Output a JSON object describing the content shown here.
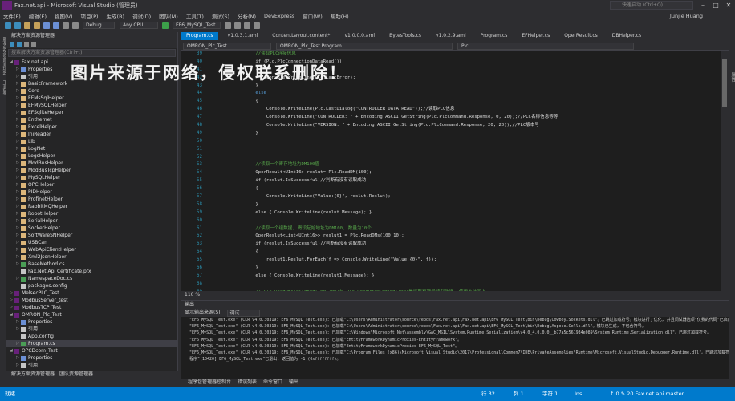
{
  "window": {
    "title": "Fax.net.api - Microsoft Visual Studio (管理员)",
    "quick_launch": "快速启动 (Ctrl+Q)",
    "user": "Junjie Huang"
  },
  "menu": [
    "文件(F)",
    "编辑(E)",
    "视图(V)",
    "项目(P)",
    "生成(B)",
    "调试(D)",
    "团队(M)",
    "工具(T)",
    "测试(S)",
    "分析(N)",
    "DevExpress",
    "窗口(W)",
    "帮助(H)"
  ],
  "toolbar": {
    "config": "Debug",
    "platform": "Any CPU",
    "startup": "EF6_MySQL_Test"
  },
  "left_strip": [
    "服务器资源管理器",
    "工具箱"
  ],
  "right_strip": [
    "属性"
  ],
  "solution_explorer": {
    "title": "解决方案资源管理器",
    "search_placeholder": "搜索解决方案资源管理器(Ctrl+;)",
    "items": [
      {
        "label": "Fax.net.api",
        "type": "proj",
        "indent": 0,
        "arrow": "◢"
      },
      {
        "label": "Properties",
        "type": "prop",
        "indent": 1,
        "arrow": "▷"
      },
      {
        "label": "引用",
        "type": "file",
        "indent": 1,
        "arrow": "▷"
      },
      {
        "label": "BasicFramework",
        "type": "folder",
        "indent": 1,
        "arrow": "▷"
      },
      {
        "label": "Core",
        "type": "folder",
        "indent": 1,
        "arrow": "▷"
      },
      {
        "label": "EFMsSqlHelper",
        "type": "folder",
        "indent": 1,
        "arrow": "▷"
      },
      {
        "label": "EFMySQLHelper",
        "type": "folder",
        "indent": 1,
        "arrow": "▷"
      },
      {
        "label": "EFSqliteHelper",
        "type": "folder",
        "indent": 1,
        "arrow": "▷"
      },
      {
        "label": "Enthernet",
        "type": "folder",
        "indent": 1,
        "arrow": "▷"
      },
      {
        "label": "ExcelHelper",
        "type": "folder",
        "indent": 1,
        "arrow": "▷"
      },
      {
        "label": "IniReader",
        "type": "folder",
        "indent": 1,
        "arrow": "▷"
      },
      {
        "label": "Lib",
        "type": "folder",
        "indent": 1,
        "arrow": "▷"
      },
      {
        "label": "LogNet",
        "type": "folder",
        "indent": 1,
        "arrow": "▷"
      },
      {
        "label": "LogsHelper",
        "type": "folder",
        "indent": 1,
        "arrow": "▷"
      },
      {
        "label": "ModBusHelper",
        "type": "folder",
        "indent": 1,
        "arrow": "▷"
      },
      {
        "label": "ModBusTcpHelper",
        "type": "folder",
        "indent": 1,
        "arrow": "▷"
      },
      {
        "label": "MySQLHelper",
        "type": "folder",
        "indent": 1,
        "arrow": "▷"
      },
      {
        "label": "OPCHelper",
        "type": "folder",
        "indent": 1,
        "arrow": "▷"
      },
      {
        "label": "PIDHelper",
        "type": "folder",
        "indent": 1,
        "arrow": "▷"
      },
      {
        "label": "ProfinetHelper",
        "type": "folder",
        "indent": 1,
        "arrow": "▷"
      },
      {
        "label": "RabbitMQHelper",
        "type": "folder",
        "indent": 1,
        "arrow": "▷"
      },
      {
        "label": "RobotHelper",
        "type": "folder",
        "indent": 1,
        "arrow": "▷"
      },
      {
        "label": "SerialHelper",
        "type": "folder",
        "indent": 1,
        "arrow": "▷"
      },
      {
        "label": "SocketHelper",
        "type": "folder",
        "indent": 1,
        "arrow": "▷"
      },
      {
        "label": "SoftWareSNHelper",
        "type": "folder",
        "indent": 1,
        "arrow": "▷"
      },
      {
        "label": "USBCan",
        "type": "folder",
        "indent": 1,
        "arrow": "▷"
      },
      {
        "label": "WebApiClientHelper",
        "type": "folder",
        "indent": 1,
        "arrow": "▷"
      },
      {
        "label": "Xml2JsonHelper",
        "type": "folder",
        "indent": 1,
        "arrow": "▷"
      },
      {
        "label": "BaseMethod.cs",
        "type": "cs",
        "indent": 1,
        "arrow": "▷"
      },
      {
        "label": "Fax.Net.Api Certificate.pfx",
        "type": "file",
        "indent": 1,
        "arrow": ""
      },
      {
        "label": "NamespaceDoc.cs",
        "type": "cs",
        "indent": 1,
        "arrow": "▷"
      },
      {
        "label": "packages.config",
        "type": "file",
        "indent": 1,
        "arrow": ""
      },
      {
        "label": "MelsecPLC_Test",
        "type": "proj",
        "indent": 0,
        "arrow": "▷"
      },
      {
        "label": "ModbusServer_test",
        "type": "proj",
        "indent": 0,
        "arrow": "▷"
      },
      {
        "label": "ModbusTCP_Test",
        "type": "proj",
        "indent": 0,
        "arrow": "▷"
      },
      {
        "label": "OMRON_Plc_Test",
        "type": "proj",
        "indent": 0,
        "arrow": "◢"
      },
      {
        "label": "Properties",
        "type": "prop",
        "indent": 1,
        "arrow": "▷"
      },
      {
        "label": "引用",
        "type": "file",
        "indent": 1,
        "arrow": "▷"
      },
      {
        "label": "App.config",
        "type": "file",
        "indent": 1,
        "arrow": ""
      },
      {
        "label": "Program.cs",
        "type": "cs",
        "indent": 1,
        "arrow": "▷",
        "selected": true
      },
      {
        "label": "OPCDcom_Test",
        "type": "proj",
        "indent": 0,
        "arrow": "◢"
      },
      {
        "label": "Properties",
        "type": "prop",
        "indent": 1,
        "arrow": "▷"
      },
      {
        "label": "引用",
        "type": "file",
        "indent": 1,
        "arrow": "▷"
      }
    ],
    "bottom_tabs": [
      "解决方案资源管理器",
      "团队资源管理器"
    ]
  },
  "editor": {
    "tabs": [
      "Program.cs",
      "v1.0.3.1.aml",
      "ContentLayout.content*",
      "v1.0.0.0.aml",
      "BytesTools.cs",
      "v1.0.2.9.aml",
      "Program.cs",
      "EFHelper.cs",
      "OperResult.cs",
      "DBHelper.cs"
    ],
    "nav_left": "OMRON_Plc_Test",
    "nav_mid": "OMRON_Plc_Test.Program",
    "nav_right": "Plc",
    "zoom": "110 %",
    "line_numbers": [
      "39",
      "40",
      "41",
      "42",
      "43",
      "44",
      "45",
      "46",
      "47",
      "48",
      "49",
      "50",
      "51",
      "52",
      "53",
      "54",
      "55",
      "56",
      "57",
      "58",
      "59",
      "60",
      "61",
      "62",
      "63",
      "64",
      "65",
      "66",
      "67",
      "68",
      "69",
      "70",
      "71",
      "72",
      "73",
      "74"
    ],
    "lines": [
      {
        "t": "            //读取PLC连接信息",
        "c": "cm"
      },
      {
        "t": "            if (Plc.PlcConnectionDataRead())",
        "c": ""
      },
      {
        "t": "            {",
        "c": ""
      },
      {
        "t": "                Console.WriteLine(Plc.LastError);",
        "c": ""
      },
      {
        "t": "            }",
        "c": ""
      },
      {
        "t": "            else",
        "c": "kw"
      },
      {
        "t": "            {",
        "c": ""
      },
      {
        "t": "                Console.WriteLine(Plc.LastDialog(\"CONTROLLER DATA READ\"));//读取PLC信息",
        "c": ""
      },
      {
        "t": "                Console.WriteLine(\"CONTROLLER: \" + Encoding.ASCII.GetString(Plc.PlcCommand.Response, 0, 20));//PLC名称信息等等",
        "c": ""
      },
      {
        "t": "                Console.WriteLine(\"VERSION: \" + Encoding.ASCII.GetString(Plc.PlcCommand.Response, 20, 20));//PLC版本号",
        "c": ""
      },
      {
        "t": "            }",
        "c": ""
      },
      {
        "t": "",
        "c": ""
      },
      {
        "t": "",
        "c": ""
      },
      {
        "t": "",
        "c": ""
      },
      {
        "t": "            //读取一个寄存地址为DM100值",
        "c": "cm"
      },
      {
        "t": "            OperResult<UInt16> reslut= Plc.ReadDM(100);",
        "c": ""
      },
      {
        "t": "            if (reslut.IsSuccessful)//判断有没有读取成功",
        "c": ""
      },
      {
        "t": "            {",
        "c": ""
      },
      {
        "t": "                Console.WriteLine(\"Value:{0}\", reslut.Reslut);",
        "c": ""
      },
      {
        "t": "            }",
        "c": ""
      },
      {
        "t": "            else { Console.WriteLine(reslut.Message); }",
        "c": ""
      },
      {
        "t": "",
        "c": ""
      },
      {
        "t": "            //读取一个组数据, 寄设起始地址为DM100, 数量为10个",
        "c": "cm"
      },
      {
        "t": "            OperReslut<List<UInt16>> reslut1 = Plc.ReadDMs(100,10);",
        "c": ""
      },
      {
        "t": "            if (reslut.IsSuccessful)//判断有没有读取成功",
        "c": ""
      },
      {
        "t": "            {",
        "c": ""
      },
      {
        "t": "                reslut1.Reslut.ForEach(f => Console.WriteLine(\"Value:{0}\", f));",
        "c": ""
      },
      {
        "t": "            }",
        "c": ""
      },
      {
        "t": "            else { Console.WriteLine(reslut1.Message); }",
        "c": ""
      },
      {
        "t": "",
        "c": ""
      },
      {
        "t": "            // Plc.ReadDMsToSigned(100,100)与 Plc.ReadDMToSigned(100)是读取有符号整型数据, 使用方法同上,",
        "c": "cm"
      },
      {
        "t": "            //下面是写入数据的示例",
        "c": "cm"
      }
    ]
  },
  "watermark": "图片来源于网络，侵权联系删除！",
  "output": {
    "title": "输出",
    "source_label": "显示输出来源(S):",
    "source_value": "调试",
    "lines": [
      "\"EF6_MySQL_Test.exe\" (CLR v4.0.30319: EF6_MySQL_Test.exe): 已加载\"C:\\Users\\Administrator\\source\\repos\\Fax.net.api\\Fax.net.api\\EF6_MySQL_Test\\bin\\Debug\\Cowboy.Sockets.dll\"。已跳过加载符号。模块进行了优化, 并且调试器选项\"仅我的代码\"已启用。",
      "\"EF6_MySQL_Test.exe\" (CLR v4.0.30319: EF6_MySQL_Test.exe): 已加载\"C:\\Users\\Administrator\\source\\repos\\Fax.net.api\\Fax.net.api\\EF6_MySQL_Test\\bin\\Debug\\Aspose.Cells.dll\"。模块已生成, 不包含符号。",
      "\"EF6_MySQL_Test.exe\" (CLR v4.0.30319: EF6_MySQL_Test.exe): 已加载\"C:\\Windows\\Microsoft.Net\\assembly\\GAC_MSIL\\System.Runtime.Serialization\\v4.0_4.0.0.0__b77a5c561934e089\\System.Runtime.Serialization.dll\"。已跳过加载符号。",
      "\"EF6_MySQL_Test.exe\" (CLR v4.0.30319: EF6_MySQL_Test.exe): 已加载\"EntityFrameworkDynamicProxies-EntityFramework\"。",
      "\"EF6_MySQL_Test.exe\" (CLR v4.0.30319: EF6_MySQL_Test.exe): 已加载\"EntityFrameworkDynamicProxies-EF6_MySQL_Test\"。",
      "\"EF6_MySQL_Test.exe\" (CLR v4.0.30319: EF6_MySQL_Test.exe): 已加载\"C:\\Program Files (x86)\\Microsoft Visual Studio\\2017\\Professional\\Common7\\IDE\\PrivateAssemblies\\Runtime\\Microsoft.VisualStudio.Debugger.Runtime.dll\"。已跳过加载符号",
      "程序\"[10420] EF6_MySQL_Test.exe\"已退出, 返回值为 -1 (0xffffffff)。"
    ],
    "bottom_tabs": [
      "程序包管理器控制台",
      "错误列表",
      "命令窗口",
      "输出"
    ]
  },
  "status": {
    "left": "就绪",
    "ln": "行 32",
    "col": "列 1",
    "ch": "字符 1",
    "mode": "Ins",
    "right": "↑ 0  ✎ 20  Fax.net.api  master"
  },
  "colors": {
    "accent": "#007acc",
    "background": "#2d2d30",
    "editor_bg": "#1e1e1e"
  }
}
